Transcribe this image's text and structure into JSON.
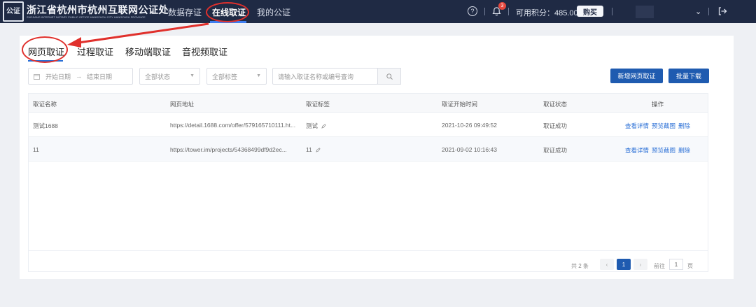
{
  "header": {
    "logo_seal_text": "公证",
    "logo_title": "浙江省杭州市杭州互联网公证处",
    "logo_subtitle": "ZHEJIANG INTERNET NOTARY PUBLIC OFFICE HANGZHOU CITY HANGZHOU PROVINCE",
    "nav": [
      "数据存证",
      "在线取证",
      "我的公证"
    ],
    "active_nav": "在线取证",
    "help_icon": "help-icon",
    "notification_badge": "3",
    "points_label": "可用积分：485.00",
    "buy_label": "购买"
  },
  "tabs": [
    "网页取证",
    "过程取证",
    "移动端取证",
    "音视频取证"
  ],
  "filters": {
    "start_date_placeholder": "开始日期",
    "date_separator": "→",
    "end_date_placeholder": "结束日期",
    "status": "全部状态",
    "tags": "全部标签",
    "search_placeholder": "请输入取证名称或编号查询"
  },
  "actions": {
    "new_button": "新增网页取证",
    "batch_download": "批量下载"
  },
  "table": {
    "headers": [
      "取证名称",
      "网页地址",
      "取证标签",
      "取证开始时间",
      "取证状态",
      "操作"
    ],
    "rows": [
      {
        "name": "测试1688",
        "url": "https://detail.1688.com/offer/579165710111.ht...",
        "tag": "测试",
        "start_time": "2021-10-26 09:49:52",
        "status": "取证成功",
        "ops": [
          "查看详情",
          "预览截图",
          "删除"
        ]
      },
      {
        "name": "11",
        "url": "https://tower.im/projects/54368499df9d2ec...",
        "tag": "11",
        "start_time": "2021-09-02 10:16:43",
        "status": "取证成功",
        "ops": [
          "查看详情",
          "预览截图",
          "删除"
        ]
      }
    ]
  },
  "pagination": {
    "total": "共 2 条",
    "prev": "‹",
    "current_page": "1",
    "next": "›",
    "goto_label": "前往",
    "goto_value": "1",
    "page_suffix": "页"
  },
  "annotation_color": "#e0302c",
  "accent_color": "#1f5bb0"
}
